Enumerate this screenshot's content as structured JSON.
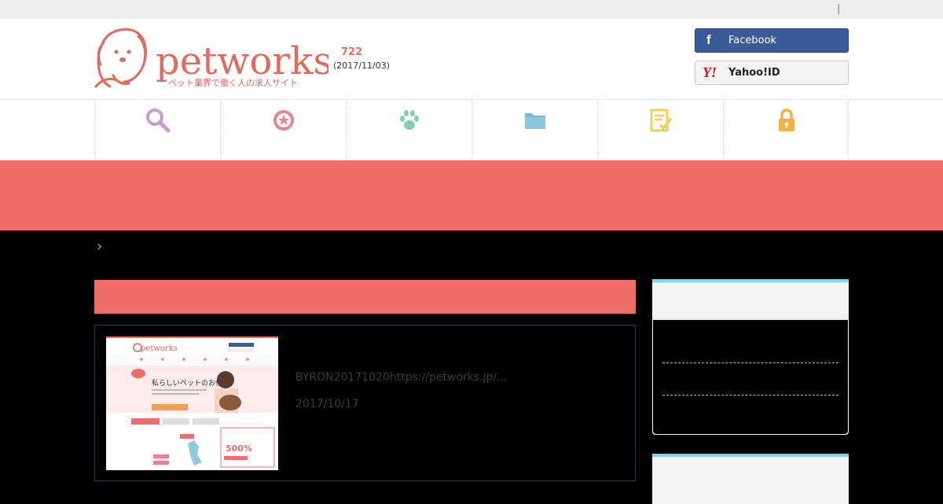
{
  "topbar": {
    "separator": "|"
  },
  "brand": {
    "name": "petworks",
    "tagline": "ペット業界で働く人の求人サイト",
    "count": "722",
    "date": "(2017/11/03)"
  },
  "login": {
    "facebook_label": "Facebook",
    "facebook_icon": "f",
    "yahoo_label": "Yahoo!ID",
    "yahoo_icon": "Y!"
  },
  "nav": {
    "items": [
      {
        "icon": "search-icon",
        "color": "#c99bd2"
      },
      {
        "icon": "badge-star-icon",
        "color": "#ec8193"
      },
      {
        "icon": "paw-icon",
        "color": "#7fcfb1"
      },
      {
        "icon": "folder-icon",
        "color": "#79b9d2"
      },
      {
        "icon": "checklist-icon",
        "color": "#f2cd5c"
      },
      {
        "icon": "lock-icon",
        "color": "#f5b13e"
      }
    ]
  },
  "breadcrumb": {
    "icon": "chevron-right-icon",
    "glyph": "›"
  },
  "article": {
    "title": "BYRON20171020https://petworks.jp/...",
    "date": "2017/10/17",
    "thumb": {
      "logo": "petworks",
      "headline": "私らしいペットのお仕事",
      "badge": "500%"
    }
  },
  "colors": {
    "accent": "#f06e6a",
    "sidebar_top": "#7dd3f7"
  }
}
